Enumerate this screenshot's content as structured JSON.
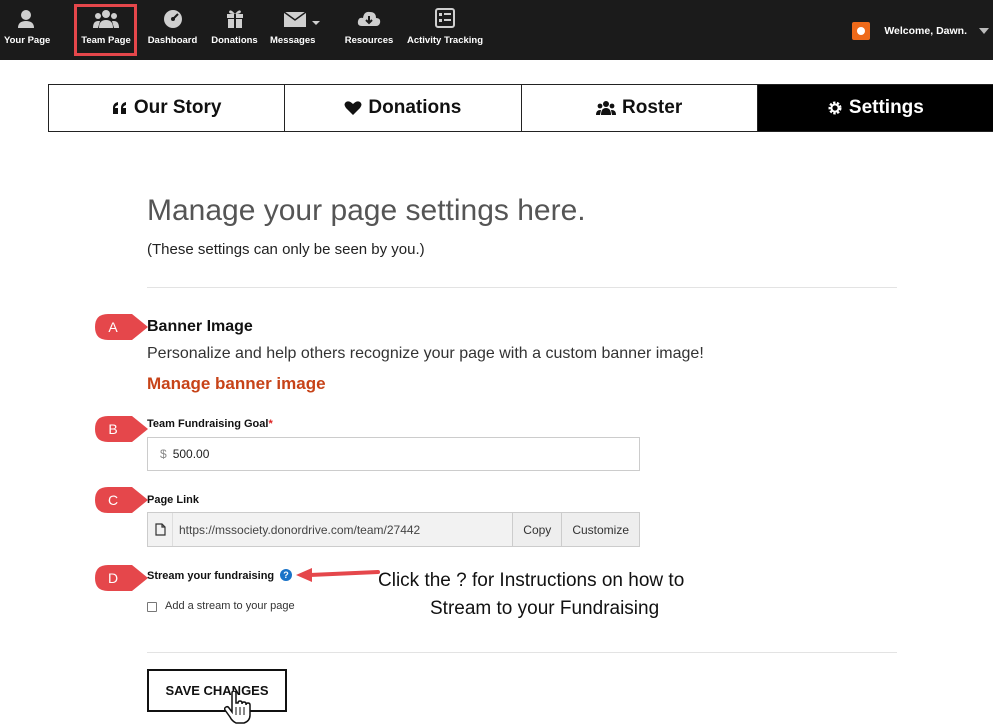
{
  "topnav": {
    "items": [
      {
        "label": "Your Page",
        "icon": "user-icon"
      },
      {
        "label": "Team Page",
        "icon": "team-icon"
      },
      {
        "label": "Dashboard",
        "icon": "dashboard-icon"
      },
      {
        "label": "Donations",
        "icon": "gift-icon"
      },
      {
        "label": "Messages",
        "icon": "envelope-icon"
      },
      {
        "label": "Resources",
        "icon": "cloud-download-icon"
      },
      {
        "label": "Activity Tracking",
        "icon": "list-icon"
      }
    ],
    "welcome": "Welcome, Dawn."
  },
  "tabs": [
    {
      "label": "Our Story",
      "icon": "quote-icon"
    },
    {
      "label": "Donations",
      "icon": "heart-icon"
    },
    {
      "label": "Roster",
      "icon": "users-icon"
    },
    {
      "label": "Settings",
      "icon": "gear-icon",
      "active": true
    }
  ],
  "page": {
    "heading": "Manage your page settings here.",
    "subheading": "(These settings can only be seen by you.)"
  },
  "banner": {
    "title": "Banner Image",
    "description": "Personalize and help others recognize your page with a custom banner image!",
    "link": "Manage banner image"
  },
  "goal": {
    "label": "Team Fundraising Goal",
    "required": "*",
    "currency": "$",
    "value": "500.00"
  },
  "page_link": {
    "label": "Page Link",
    "url": "https://mssociety.donordrive.com/team/27442",
    "copy": "Copy",
    "customize": "Customize"
  },
  "stream": {
    "label": "Stream your fundraising",
    "help": "?",
    "checkbox_label": "Add a stream to your page"
  },
  "annotation": {
    "line1": "Click the ? for Instructions on how to",
    "line2": "Stream to your Fundraising"
  },
  "markers": [
    "A",
    "B",
    "C",
    "D"
  ],
  "save": "SAVE CHANGES",
  "colors": {
    "accent": "#c74318",
    "marker": "#e5474b",
    "help": "#1a73c8",
    "nav": "#1b1b1b"
  }
}
